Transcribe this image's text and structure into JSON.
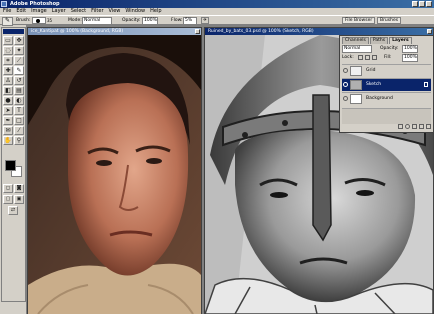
{
  "app": {
    "title": "Adobe Photoshop"
  },
  "menu": [
    "File",
    "Edit",
    "Image",
    "Layer",
    "Select",
    "Filter",
    "View",
    "Window",
    "Help"
  ],
  "options": {
    "brush_label": "Brush:",
    "brush_size": "35",
    "mode_label": "Mode:",
    "mode_value": "Normal",
    "opacity_label": "Opacity:",
    "opacity_value": "100%",
    "flow_label": "Flow:",
    "flow_value": "5%"
  },
  "palette_well": {
    "file_browser": "File Browser",
    "brushes": "Brushes"
  },
  "documents": {
    "left_title": "ice_Kantipat @ 100% (Background, RGB)",
    "right_title": "Ruined_by_bats_03.psd @ 100% (Sketch, RGB)"
  },
  "layers_panel": {
    "tabs": [
      "Channels",
      "Paths",
      "Layers"
    ],
    "active_tab": "Layers",
    "blend_mode": "Normal",
    "opacity_label": "Opacity:",
    "opacity_value": "100%",
    "lock_label": "Lock:",
    "fill_label": "Fill:",
    "fill_value": "100%",
    "layers": [
      {
        "name": "Grid",
        "selected": false
      },
      {
        "name": "Sketch",
        "selected": true
      },
      {
        "name": "Background",
        "selected": false
      }
    ]
  },
  "colors": {
    "foreground": "#000000",
    "background": "#ffffff",
    "title_active": "#0a246a"
  }
}
